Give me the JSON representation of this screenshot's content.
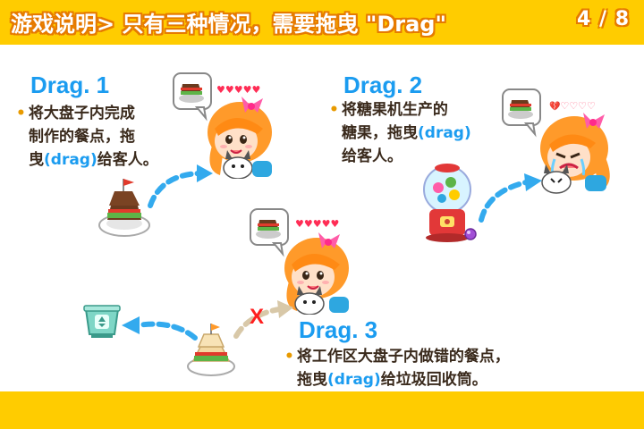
{
  "header": {
    "title": "游戏说明> 只有三种情况，需要拖曳 \"Drag\"",
    "page_counter": "4 / 8"
  },
  "sections": [
    {
      "title": "Drag. 1",
      "line1": "将大盘子内完成",
      "line2": "制作的餐点，拖",
      "line3_a": "曳",
      "line3_kw": "(drag)",
      "line3_b": "给客人。"
    },
    {
      "title": "Drag. 2",
      "line1": "将糖果机生产的",
      "line2_a": "糖果，拖曳",
      "line2_kw": "(drag)",
      "line3": "给客人。"
    },
    {
      "title": "Drag. 3",
      "line1": "将工作区大盘子内做错的餐点，",
      "line2_a": "拖曳",
      "line2_kw": "(drag)",
      "line2_b": "给垃圾回收筒。"
    }
  ],
  "bullet": "•",
  "x_mark": "X",
  "hearts": {
    "full": "♥♥♥♥♥",
    "broken": "💔",
    "empty": "♡♡♡♡"
  },
  "colors": {
    "header_bg": "#ffcc00",
    "title_blue": "#1b9cf0",
    "arrow_blue": "#33aaee",
    "arrow_grey": "#d8c8a8",
    "x_red": "#ff1f1f"
  }
}
